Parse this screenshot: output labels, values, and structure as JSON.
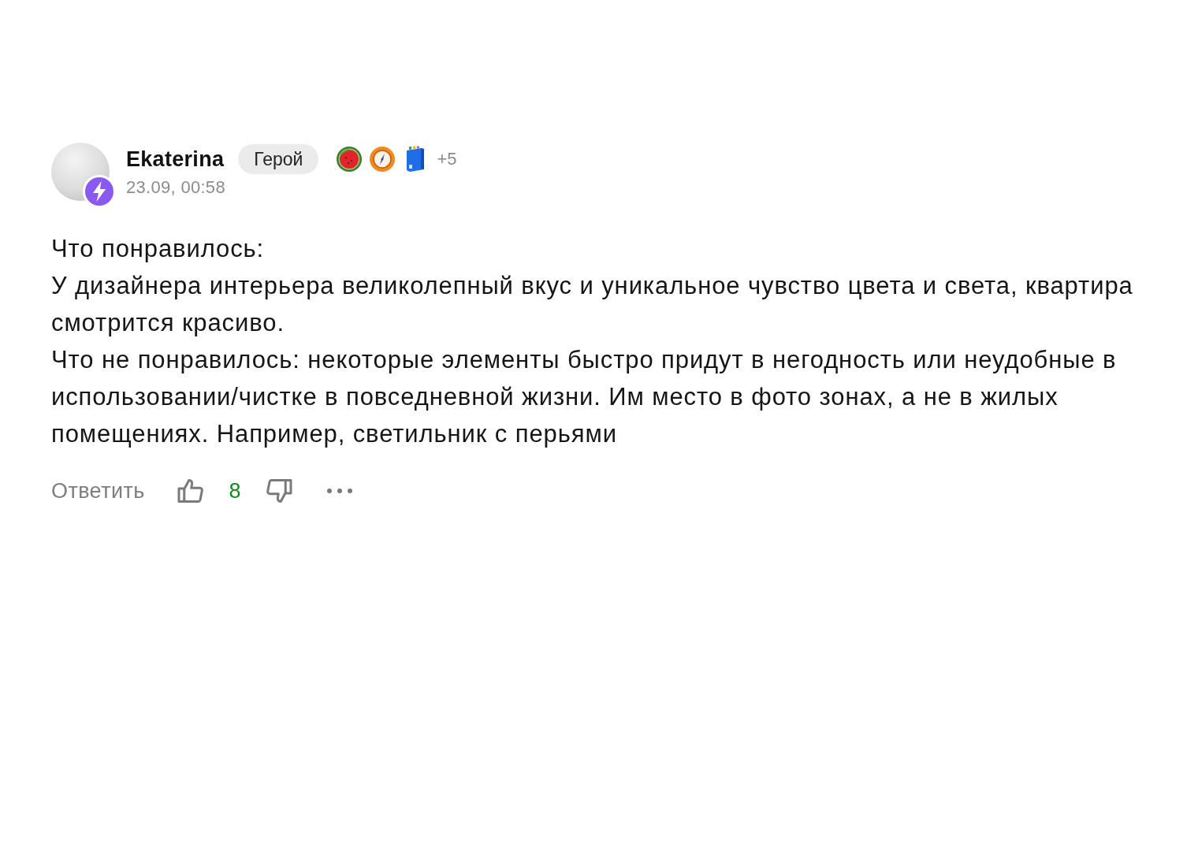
{
  "comment": {
    "author": {
      "name": "Ekaterina",
      "rank": "Герой",
      "more_awards": "+5"
    },
    "time": "23.09, 00:58",
    "body": [
      "Что понравилось:",
      "У дизайнера интерьера великолепный вкус и уникальное чувство цвета и света, квартира смотрится красиво.",
      "Что не понравилось: некоторые элементы быстро придут в негодность или неудобные в использовании/чистке в повседневной жизни. Им место в фото зонах, а не в жилых помещениях. Например, светильник с перьями"
    ],
    "actions": {
      "reply": "Ответить",
      "likes": "8"
    }
  }
}
